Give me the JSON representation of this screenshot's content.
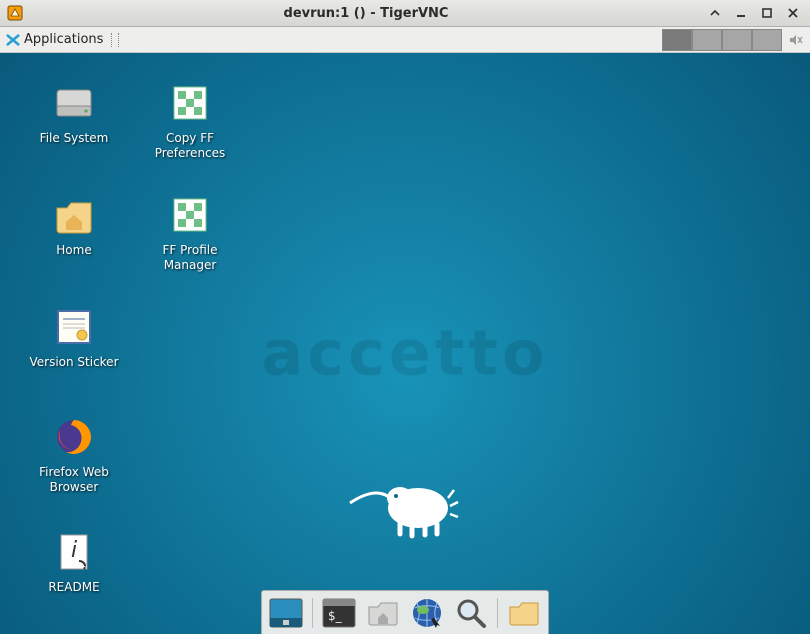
{
  "window": {
    "title": "devrun:1 () - TigerVNC"
  },
  "panel": {
    "applications_label": "Applications"
  },
  "watermark": "accetto",
  "icons": {
    "file_system": "File System",
    "copy_ff": "Copy FF Preferences",
    "home": "Home",
    "ff_profile": "FF Profile Manager",
    "version_sticker": "Version Sticker",
    "firefox": "Firefox Web Browser",
    "readme": "README"
  }
}
